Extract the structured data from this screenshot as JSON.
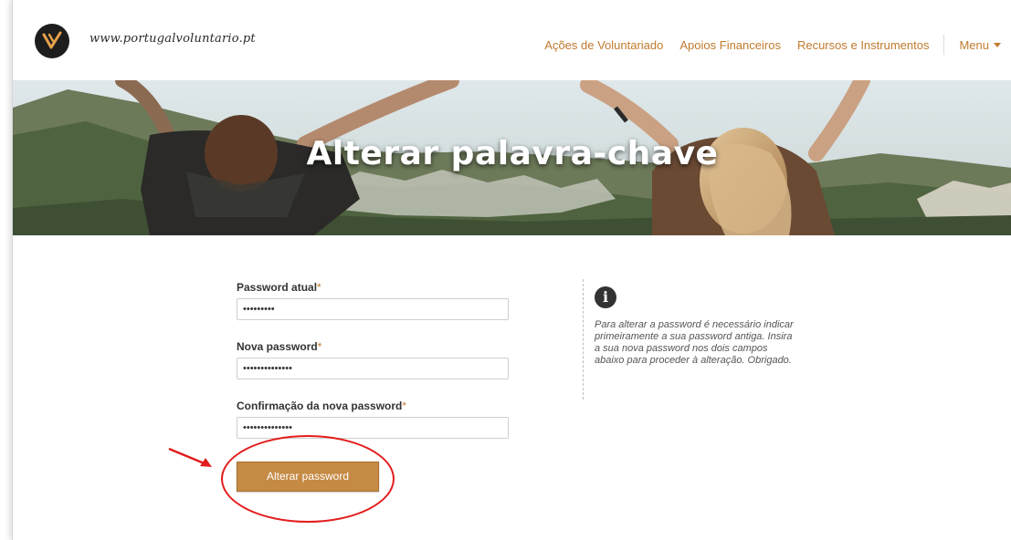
{
  "header": {
    "site_url": "www.portugalvoluntario.pt",
    "nav": [
      "Ações de Voluntariado",
      "Apoios Financeiros",
      "Recursos e Instrumentos"
    ],
    "menu_label": "Menu"
  },
  "banner": {
    "title": "Alterar palavra-chave"
  },
  "form": {
    "current_password": {
      "label": "Password atual",
      "required": "*",
      "value": "•••••••••"
    },
    "new_password": {
      "label": "Nova password",
      "required": "*",
      "value": "••••••••••••••"
    },
    "confirm_password": {
      "label": "Confirmação da nova password",
      "required": "*",
      "value": "••••••••••••••"
    },
    "submit_label": "Alterar password"
  },
  "info": {
    "icon": "info-icon",
    "text": "Para alterar a password é necessário indicar primeiramente a sua password antiga. Insira a sua nova password nos dois campos abaixo para proceder à alteração. Obrigado."
  },
  "colors": {
    "accent": "#c07a2e",
    "button": "#c58a44",
    "annotation": "#e21d1d"
  }
}
